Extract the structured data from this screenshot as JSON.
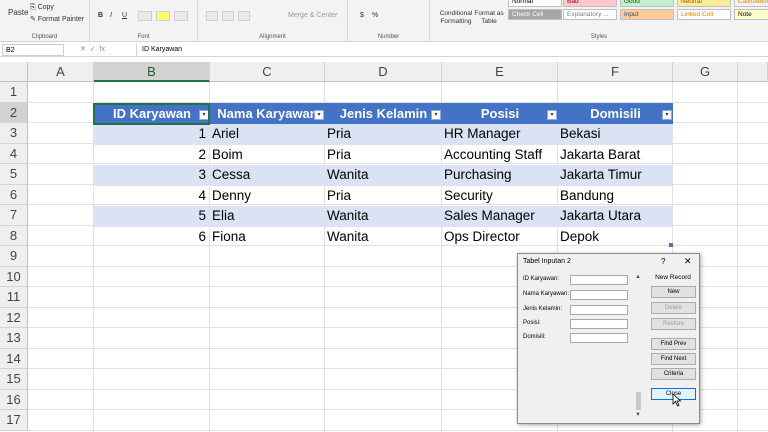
{
  "ribbon": {
    "clipboard": {
      "copy": "Copy",
      "format_painter": "Format Painter",
      "label": "Clipboard",
      "paste": "Paste"
    },
    "font": {
      "label": "Font",
      "bold": "B",
      "italic": "I",
      "underline": "U"
    },
    "alignment": {
      "label": "Alignment",
      "merge": "Merge & Center"
    },
    "number": {
      "label": "Number",
      "currency": "$",
      "percent": "%"
    },
    "styles": {
      "label": "Styles",
      "conditional": "Conditional Formatting",
      "format_table": "Format as Table",
      "cells": [
        {
          "text": "Normal",
          "bg": "#ffffff",
          "color": "#000000"
        },
        {
          "text": "Bad",
          "bg": "#ffc7ce",
          "color": "#9c0006"
        },
        {
          "text": "Good",
          "bg": "#c6efce",
          "color": "#006100"
        },
        {
          "text": "Neutral",
          "bg": "#ffeb9c",
          "color": "#9c5700"
        },
        {
          "text": "Calculation",
          "bg": "#f2f2f2",
          "color": "#fa7d00"
        },
        {
          "text": "Check Cell",
          "bg": "#a5a5a5",
          "color": "#ffffff"
        },
        {
          "text": "Explanatory ...",
          "bg": "#ffffff",
          "color": "#7f7f7f"
        },
        {
          "text": "Input",
          "bg": "#ffcc99",
          "color": "#3f3f76"
        },
        {
          "text": "Linked Cell",
          "bg": "#ffffff",
          "color": "#fa7d00"
        },
        {
          "text": "Note",
          "bg": "#ffffcc",
          "color": "#000000"
        }
      ]
    }
  },
  "formula_bar": {
    "name_box": "B2",
    "fx": "fx",
    "content": "ID Karyawan"
  },
  "columns": [
    "A",
    "B",
    "C",
    "D",
    "E",
    "F",
    "G"
  ],
  "rows": [
    "1",
    "2",
    "3",
    "4",
    "5",
    "6",
    "7",
    "8",
    "9",
    "10",
    "11",
    "12",
    "13",
    "14",
    "15",
    "16",
    "17"
  ],
  "table": {
    "headers": [
      "ID Karyawan",
      "Nama Karyawan",
      "Jenis Kelamin",
      "Posisi",
      "Domisili"
    ],
    "rows": [
      {
        "id": "1",
        "nama": "Ariel",
        "jk": "Pria",
        "posisi": "HR Manager",
        "domisili": "Bekasi"
      },
      {
        "id": "2",
        "nama": "Boim",
        "jk": "Pria",
        "posisi": "Accounting Staff",
        "domisili": "Jakarta Barat"
      },
      {
        "id": "3",
        "nama": "Cessa",
        "jk": "Wanita",
        "posisi": "Purchasing",
        "domisili": "Jakarta Timur"
      },
      {
        "id": "4",
        "nama": "Denny",
        "jk": "Pria",
        "posisi": "Security",
        "domisili": "Bandung"
      },
      {
        "id": "5",
        "nama": "Elia",
        "jk": "Wanita",
        "posisi": "Sales Manager",
        "domisili": "Jakarta Utara"
      },
      {
        "id": "6",
        "nama": "Fiona",
        "jk": "Wanita",
        "posisi": "Ops Director",
        "domisili": "Depok"
      }
    ]
  },
  "dialog": {
    "title": "Tabel Inputan 2",
    "help": "?",
    "close": "✕",
    "record_info": "New Record",
    "fields": [
      "ID Karyawan:",
      "Nama Karyawan:",
      "Jenis Kelamin:",
      "Posisi:",
      "Domisili:"
    ],
    "buttons": {
      "new": "New",
      "delete": "Delete",
      "restore": "Restore",
      "find_prev": "Find Prev",
      "find_next": "Find Next",
      "criteria": "Criteria",
      "close": "Close"
    }
  },
  "colors": {
    "table_header": "#4472c4",
    "band": "#dae3f3",
    "accent": "#217346"
  }
}
